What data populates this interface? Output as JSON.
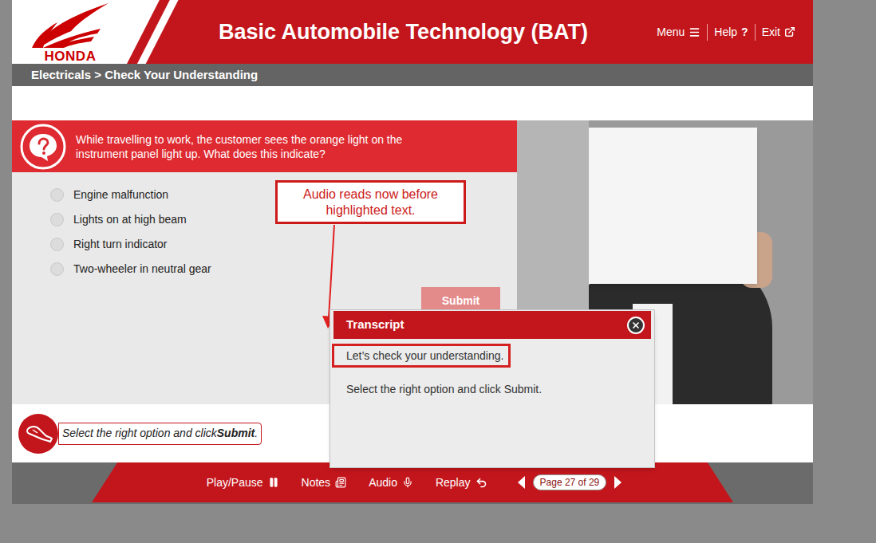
{
  "logo": {
    "text": "HONDA"
  },
  "header": {
    "title": "Basic Automobile Technology (BAT)",
    "nav": [
      {
        "label": "Menu"
      },
      {
        "label": "Help",
        "glyph": "?"
      },
      {
        "label": "Exit"
      }
    ]
  },
  "breadcrumb": {
    "text": "Electricals > Check Your Understanding"
  },
  "question": {
    "text": "While travelling to work, the customer sees the orange light on the instrument panel light up. What does this indicate?",
    "options": [
      {
        "label": "Engine malfunction",
        "selected": false
      },
      {
        "label": "Lights on at high beam",
        "selected": false
      },
      {
        "label": "Right turn indicator",
        "selected": false
      },
      {
        "label": "Two-wheeler in neutral gear",
        "selected": false
      }
    ],
    "submit": {
      "label": "Submit",
      "disabled": true
    }
  },
  "instruction": {
    "before": "Select the right option and click ",
    "bold": "Submit",
    "after": "."
  },
  "transcript": {
    "title": "Transcript",
    "lines": [
      {
        "text": "Let’s check your understanding.",
        "highlighted": true
      },
      {
        "text": "Select the right option and click Submit.",
        "highlighted": false
      }
    ]
  },
  "annotation": {
    "text": "Audio reads now before highlighted text."
  },
  "footer": {
    "controls": [
      {
        "label": "Play/Pause"
      },
      {
        "label": "Notes"
      },
      {
        "label": "Audio"
      },
      {
        "label": "Replay"
      }
    ],
    "page": "Page 27 of 29"
  }
}
